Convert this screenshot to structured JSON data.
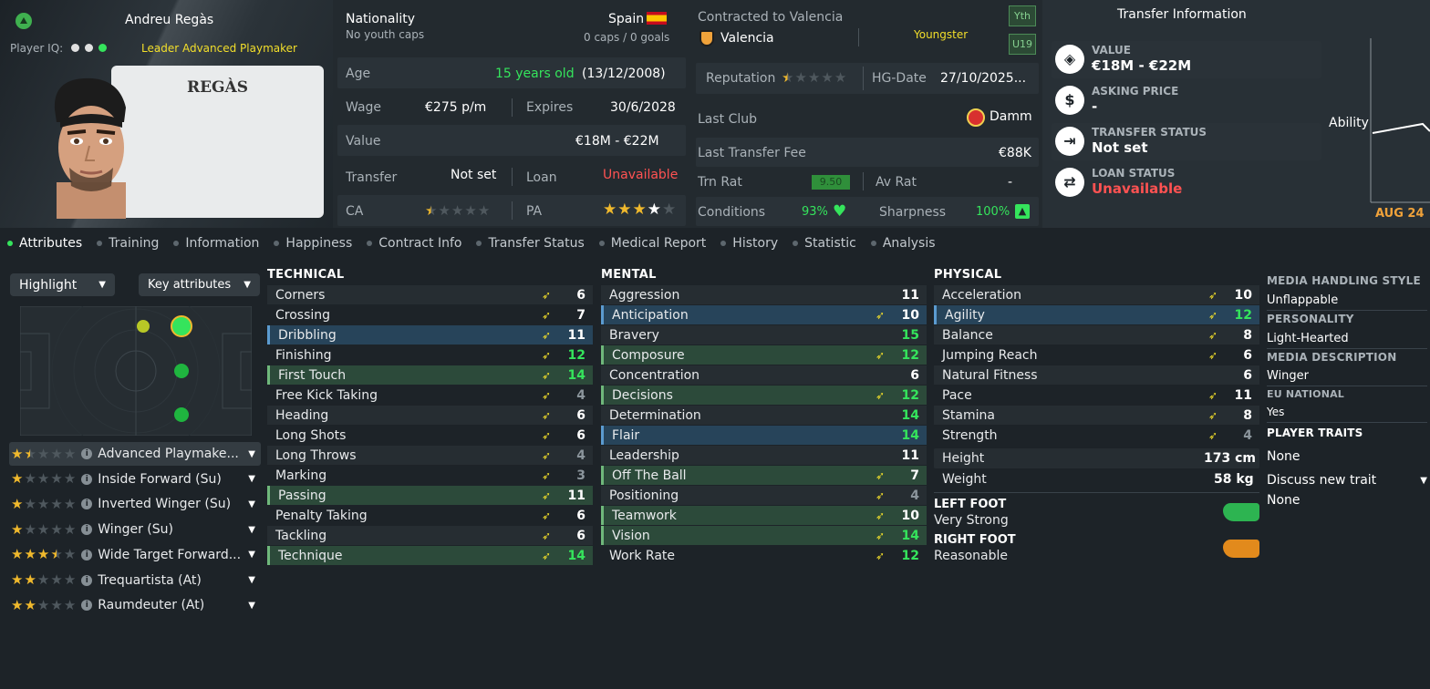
{
  "player": {
    "name": "Andreu Regàs",
    "shirt_name": "REGÀS",
    "iq_label": "Player IQ:",
    "role_label": "Leader Advanced Playmaker"
  },
  "bio": {
    "nationality_label": "Nationality",
    "nationality_value": "Spain",
    "youth_caps": "No youth caps",
    "caps_goals": "0 caps / 0 goals",
    "age_label": "Age",
    "age_value": "15 years old",
    "dob": "(13/12/2008)",
    "wage_label": "Wage",
    "wage_value": "€275 p/m",
    "expires_label": "Expires",
    "expires_value": "30/6/2028",
    "value_label": "Value",
    "value_value": "€18M - €22M",
    "transfer_label": "Transfer",
    "transfer_value": "Not set",
    "loan_label": "Loan",
    "loan_value": "Unavailable",
    "ca_label": "CA",
    "pa_label": "PA",
    "ca_stars": 1.5,
    "pa_stars": 4
  },
  "contract": {
    "contracted_label": "Contracted to Valencia",
    "club": "Valencia",
    "status": "Youngster",
    "badge_yth": "Yth",
    "badge_u19": "U19",
    "reputation_label": "Reputation",
    "reputation_stars": 0.5,
    "hg_label": "HG-Date",
    "hg_value": "27/10/2025...",
    "last_club_label": "Last Club",
    "last_club_value": "Damm",
    "last_fee_label": "Last Transfer Fee",
    "last_fee_value": "€88K",
    "trn_rat_label": "Trn Rat",
    "trn_rat_value": "9.50",
    "av_rat_label": "Av Rat",
    "av_rat_value": "-",
    "conditions_label": "Conditions",
    "conditions_value": "93%",
    "sharpness_label": "Sharpness",
    "sharpness_value": "100%"
  },
  "transfer_info": {
    "title": "Transfer Information",
    "value_label": "VALUE",
    "value": "€18M - €22M",
    "asking_label": "ASKING PRICE",
    "asking": "-",
    "status_label": "TRANSFER STATUS",
    "status": "Not set",
    "loan_label": "LOAN STATUS",
    "loan": "Unavailable",
    "chart_label": "Ability",
    "chart_month": "AUG 24"
  },
  "tabs": [
    "Attributes",
    "Training",
    "Information",
    "Happiness",
    "Contract Info",
    "Transfer Status",
    "Medical Report",
    "History",
    "Statistic",
    "Analysis"
  ],
  "controls": {
    "highlight": "Highlight",
    "key_attributes": "Key attributes"
  },
  "roles": [
    {
      "name": "Advanced Playmake...",
      "stars": 1.5
    },
    {
      "name": "Inside Forward (Su)",
      "stars": 1
    },
    {
      "name": "Inverted Winger (Su)",
      "stars": 1
    },
    {
      "name": "Winger (Su)",
      "stars": 1
    },
    {
      "name": "Wide Target Forward...",
      "stars": 3.5
    },
    {
      "name": "Trequartista (At)",
      "stars": 2
    },
    {
      "name": "Raumdeuter (At)",
      "stars": 2
    }
  ],
  "technical": {
    "title": "TECHNICAL",
    "rows": [
      {
        "name": "Corners",
        "value": "6"
      },
      {
        "name": "Crossing",
        "value": "7"
      },
      {
        "name": "Dribbling",
        "value": "11"
      },
      {
        "name": "Finishing",
        "value": "12"
      },
      {
        "name": "First Touch",
        "value": "14"
      },
      {
        "name": "Free Kick Taking",
        "value": "4"
      },
      {
        "name": "Heading",
        "value": "6"
      },
      {
        "name": "Long Shots",
        "value": "6"
      },
      {
        "name": "Long Throws",
        "value": "4"
      },
      {
        "name": "Marking",
        "value": "3"
      },
      {
        "name": "Passing",
        "value": "11"
      },
      {
        "name": "Penalty Taking",
        "value": "6"
      },
      {
        "name": "Tackling",
        "value": "6"
      },
      {
        "name": "Technique",
        "value": "14"
      }
    ]
  },
  "mental": {
    "title": "MENTAL",
    "rows": [
      {
        "name": "Aggression",
        "value": "11"
      },
      {
        "name": "Anticipation",
        "value": "10"
      },
      {
        "name": "Bravery",
        "value": "15"
      },
      {
        "name": "Composure",
        "value": "12"
      },
      {
        "name": "Concentration",
        "value": "6"
      },
      {
        "name": "Decisions",
        "value": "12"
      },
      {
        "name": "Determination",
        "value": "14"
      },
      {
        "name": "Flair",
        "value": "14"
      },
      {
        "name": "Leadership",
        "value": "11"
      },
      {
        "name": "Off The Ball",
        "value": "7"
      },
      {
        "name": "Positioning",
        "value": "4"
      },
      {
        "name": "Teamwork",
        "value": "10"
      },
      {
        "name": "Vision",
        "value": "14"
      },
      {
        "name": "Work Rate",
        "value": "12"
      }
    ]
  },
  "physical": {
    "title": "PHYSICAL",
    "rows": [
      {
        "name": "Acceleration",
        "value": "10"
      },
      {
        "name": "Agility",
        "value": "12"
      },
      {
        "name": "Balance",
        "value": "8"
      },
      {
        "name": "Jumping Reach",
        "value": "6"
      },
      {
        "name": "Natural Fitness",
        "value": "6"
      },
      {
        "name": "Pace",
        "value": "11"
      },
      {
        "name": "Stamina",
        "value": "8"
      },
      {
        "name": "Strength",
        "value": "4"
      }
    ],
    "height_label": "Height",
    "height_value": "173 cm",
    "weight_label": "Weight",
    "weight_value": "58 kg",
    "left_foot_label": "LEFT FOOT",
    "left_foot_value": "Very Strong",
    "right_foot_label": "RIGHT FOOT",
    "right_foot_value": "Reasonable"
  },
  "side": {
    "media_style_label": "MEDIA HANDLING STYLE",
    "media_style_value": "Unflappable",
    "personality_label": "PERSONALITY",
    "personality_value": "Light-Hearted",
    "media_desc_label": "MEDIA DESCRIPTION",
    "media_desc_value": "Winger",
    "eu_label": "EU NATIONAL",
    "eu_value": "Yes",
    "traits_label": "PLAYER TRAITS",
    "traits_value": "None",
    "discuss_label": "Discuss new trait",
    "discuss_value": "None"
  },
  "colors": {
    "accent_green": "#35e45c",
    "warning_red": "#ff5252",
    "yellow": "#f3df2a",
    "star_gold": "#f0b92d"
  }
}
